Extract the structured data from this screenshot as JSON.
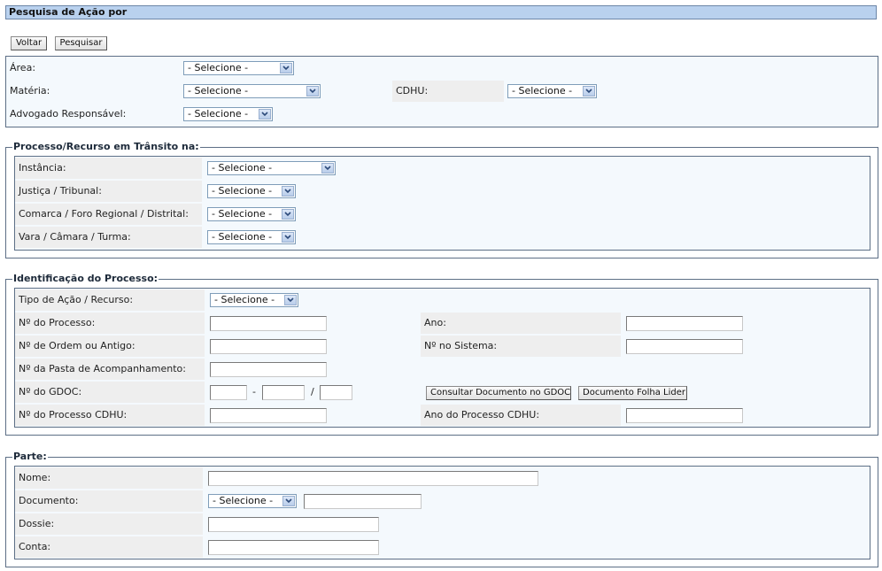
{
  "header": {
    "title": "Pesquisa de Ação por"
  },
  "toolbar": {
    "back_label": "Voltar",
    "search_label": "Pesquisar"
  },
  "select_placeholder": "- Selecione -",
  "main": {
    "area_label": "Área:",
    "materia_label": "Matéria:",
    "cdhu_label": "CDHU:",
    "advogado_label": "Advogado Responsável:"
  },
  "transito": {
    "legend": "Processo/Recurso em Trânsito na:",
    "instancia_label": "Instância:",
    "justica_label": "Justiça / Tribunal:",
    "comarca_label": "Comarca / Foro Regional / Distrital:",
    "vara_label": "Vara / Câmara / Turma:"
  },
  "identificacao": {
    "legend": "Identificação do Processo:",
    "tipo_label": "Tipo de Ação / Recurso:",
    "processo_label": "Nº do Processo:",
    "ano_label": "Ano:",
    "ordem_label": "Nº de Ordem ou Antigo:",
    "sistema_label": "Nº no Sistema:",
    "pasta_label": "Nº da Pasta de Acompanhamento:",
    "gdoc_label": "Nº do GDOC:",
    "gdoc_sep1": "-",
    "gdoc_sep2": "/",
    "consultar_label": "Consultar Documento no GDOC",
    "folha_label": "Documento Folha Lider",
    "processo_cdhu_label": "Nº do Processo CDHU:",
    "ano_cdhu_label": "Ano do Processo CDHU:"
  },
  "parte": {
    "legend": "Parte:",
    "nome_label": "Nome:",
    "documento_label": "Documento:",
    "dossie_label": "Dossie:",
    "conta_label": "Conta:"
  },
  "icons": {
    "dropdown": "chevron-down-icon"
  }
}
